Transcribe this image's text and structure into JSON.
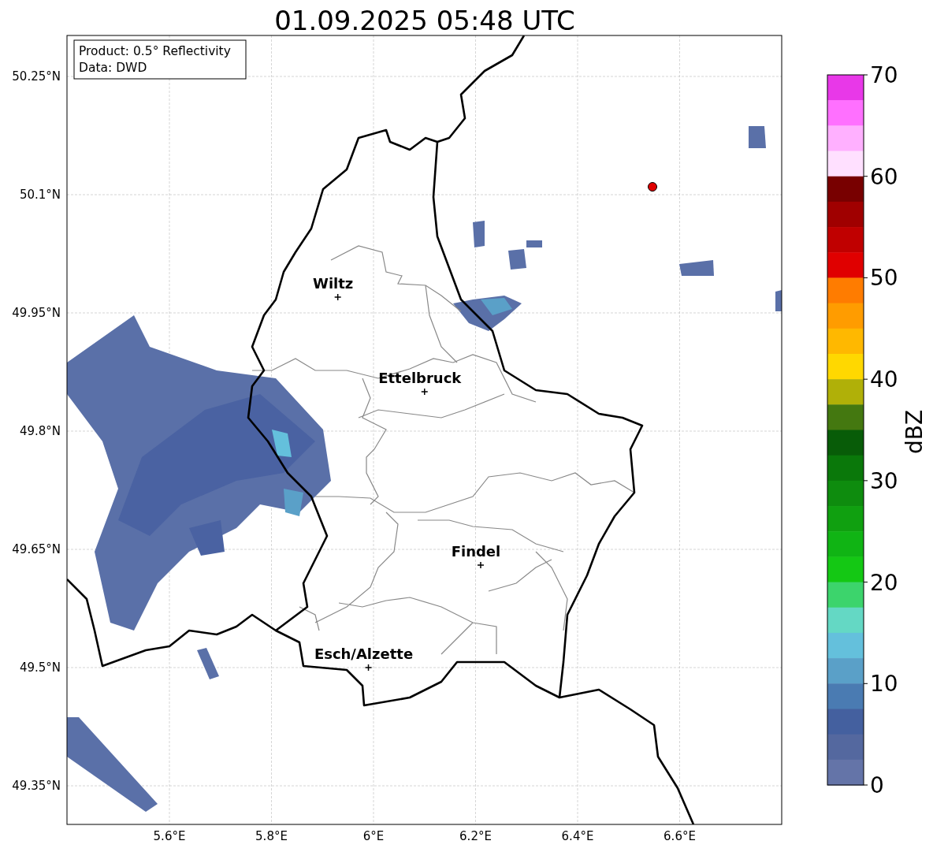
{
  "title": "01.09.2025 05:48 UTC",
  "info_box": [
    "Product: 0.5° Reflectivity",
    "Data: DWD"
  ],
  "map": {
    "lon_ticks": [
      "5.6°E",
      "5.8°E",
      "6°E",
      "6.2°E",
      "6.4°E",
      "6.6°E"
    ],
    "lat_ticks": [
      "50.25°N",
      "50.1°N",
      "49.95°N",
      "49.8°N",
      "49.65°N",
      "49.5°N",
      "49.35°N"
    ],
    "cities": [
      {
        "name": "Wiltz"
      },
      {
        "name": "Ettelbruck"
      },
      {
        "name": "Findel"
      },
      {
        "name": "Esch/Alzette"
      }
    ]
  },
  "colorbar": {
    "label": "dBZ",
    "ticks": [
      "70",
      "60",
      "50",
      "40",
      "30",
      "20",
      "10",
      "0"
    ],
    "bands": [
      {
        "color": "#e838e8"
      },
      {
        "color": "#ff70ff"
      },
      {
        "color": "#ffb0ff"
      },
      {
        "color": "#ffe0ff"
      },
      {
        "color": "#780000"
      },
      {
        "color": "#a00000"
      },
      {
        "color": "#c00000"
      },
      {
        "color": "#e00000"
      },
      {
        "color": "#ff7c00"
      },
      {
        "color": "#ff9c00"
      },
      {
        "color": "#ffb800"
      },
      {
        "color": "#ffd800"
      },
      {
        "color": "#b0b008"
      },
      {
        "color": "#447810"
      },
      {
        "color": "#085c08"
      },
      {
        "color": "#0a780a"
      },
      {
        "color": "#0e8c0e"
      },
      {
        "color": "#10a010"
      },
      {
        "color": "#10b414"
      },
      {
        "color": "#14c814"
      },
      {
        "color": "#3cd46c"
      },
      {
        "color": "#64d8c4"
      },
      {
        "color": "#64c0dc"
      },
      {
        "color": "#5aa0c8"
      },
      {
        "color": "#4a7bb2"
      },
      {
        "color": "#44609f"
      },
      {
        "color": "#54689f"
      },
      {
        "color": "#6474a8"
      }
    ]
  }
}
